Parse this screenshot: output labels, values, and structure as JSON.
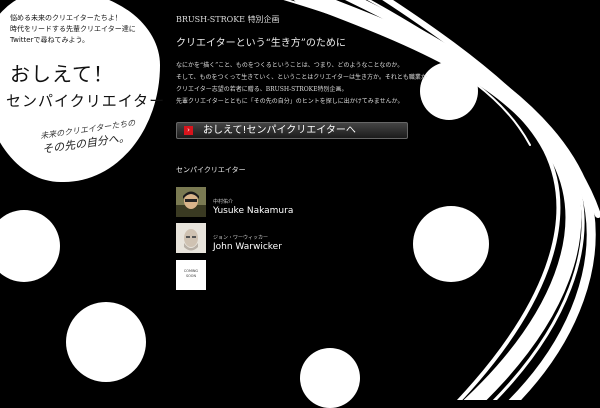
{
  "left_panel": {
    "intro_line1": "悩める未来のクリエイターたちよ！",
    "intro_line2": "時代をリードする先輩クリエイター達に",
    "intro_line3": "Twitterで尋ねてみよう。",
    "big_title_line1": "おしえて！",
    "big_title_line2": "センパイクリエイター",
    "subtitle_line1": "未来のクリエイターたちの",
    "subtitle_line2": "その先の自分へ。"
  },
  "header": {
    "brand": "BRUSH-STROKE 特別企画",
    "headline": "クリエイターという“生き方”のために"
  },
  "intro_text": {
    "line1": "なにかを“描く”こと、ものをつくるということは、つまり、どのようなことなのか。",
    "line2": "そして、ものをつくって生きていく、ということはクリエイターは生き方か。それとも職業か",
    "line3": "クリエイター志望の若者に贈る、BRUSH-STROKE特別企画。",
    "line4": "先輩クリエイターとともに「その先の自分」のヒントを探しに出かけてみませんか。"
  },
  "cta": {
    "label": "おしえて!センパイクリエイターへ",
    "arrow_icon": "›"
  },
  "creators_section": {
    "title": "センパイクリエイター",
    "items": [
      {
        "name_jp": "中村佑介",
        "name_en": "Yusuke Nakamura"
      },
      {
        "name_jp": "ジョン・ワーウィッカー",
        "name_en": "John Warwicker"
      }
    ],
    "coming_soon": {
      "line1": "COMING",
      "line2": "SOON"
    }
  },
  "colors": {
    "background": "#000000",
    "foreground": "#ffffff",
    "accent_red": "#d8141c"
  }
}
